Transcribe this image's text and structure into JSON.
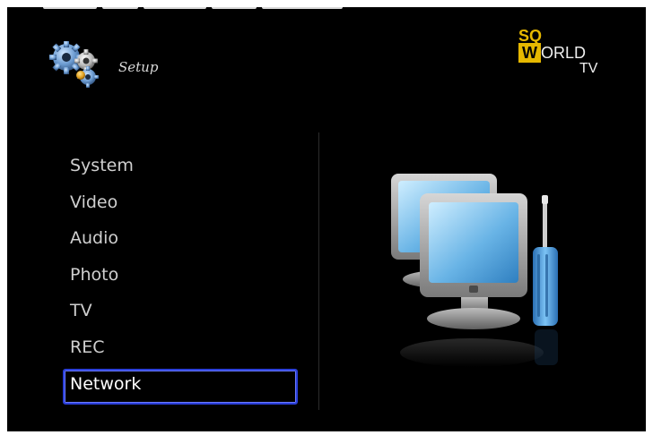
{
  "header": {
    "title": "Setup",
    "icon": "gears-icon"
  },
  "logo": {
    "line1": "SQ",
    "line2_box": "W",
    "line2_rest": "ORLD",
    "line3": "TV",
    "color": "#e6b800"
  },
  "menu": {
    "items": [
      {
        "label": "System"
      },
      {
        "label": "Video"
      },
      {
        "label": "Audio"
      },
      {
        "label": "Photo"
      },
      {
        "label": "TV"
      },
      {
        "label": "REC"
      },
      {
        "label": "Network"
      }
    ],
    "selected_index": 6,
    "highlight_color": "#2b3fd9"
  },
  "illustration": "network-settings-icon"
}
